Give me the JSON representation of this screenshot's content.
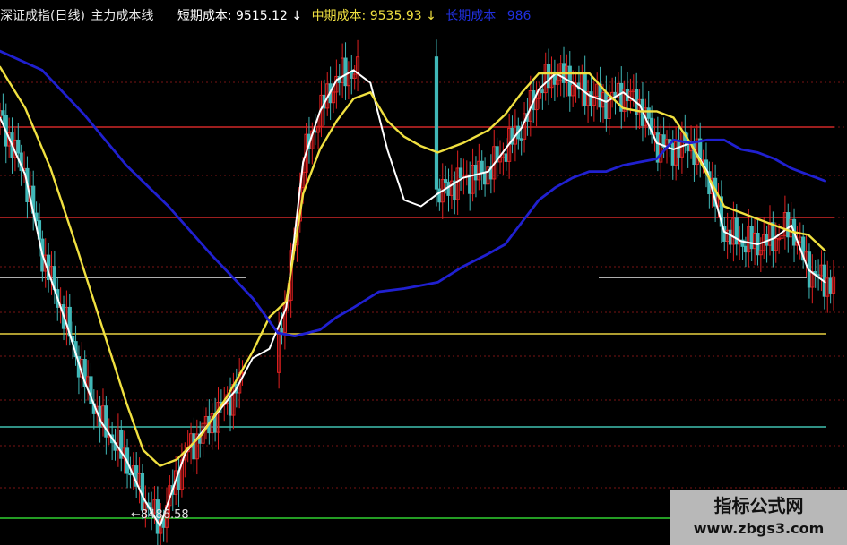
{
  "header": {
    "title": "深证成指(日线)",
    "indicator": "主力成本线",
    "short_label": "短期成本:",
    "short_value": "9515.12",
    "mid_label": "中期成本:",
    "mid_value": "9535.93",
    "long_label": "长期成本",
    "long_value": "986",
    "down_arrow": "↓"
  },
  "low_marker": "←8486.58",
  "watermark": {
    "line1": "指标公式网",
    "line2": "www.zbgs3.com"
  },
  "colors": {
    "up": "#e02020",
    "down": "#40b8b8",
    "short_line": "#ffffff",
    "mid_line": "#f0e040",
    "long_line": "#2020d0",
    "header_short": "#ffffff",
    "header_mid": "#f0e040",
    "header_long": "#2030e0"
  },
  "chart_data": {
    "type": "line",
    "title": "深证成指(日线) 主力成本线",
    "y_unit": "index points",
    "ylim": [
      8430,
      10050
    ],
    "x_count": 100,
    "series": [
      {
        "name": "短期成本",
        "color": "#ffffff",
        "x": [
          0,
          3,
          5,
          8,
          10,
          12,
          15,
          17,
          19,
          22,
          25,
          28,
          30,
          32,
          34,
          36,
          38,
          40,
          42,
          44,
          46,
          48,
          50,
          52,
          55,
          58,
          60,
          62,
          64,
          66,
          68,
          70,
          72,
          74,
          76,
          78,
          80,
          82,
          84,
          86,
          88,
          90,
          92,
          94,
          96,
          98
        ],
        "y": [
          9780,
          9600,
          9350,
          9120,
          8950,
          8820,
          8700,
          8580,
          8490,
          8720,
          8820,
          8920,
          9020,
          9050,
          9180,
          9640,
          9800,
          9900,
          9930,
          9890,
          9680,
          9520,
          9500,
          9540,
          9590,
          9610,
          9680,
          9750,
          9870,
          9920,
          9890,
          9850,
          9830,
          9860,
          9820,
          9700,
          9680,
          9700,
          9610,
          9420,
          9390,
          9380,
          9400,
          9440,
          9300,
          9260
        ]
      },
      {
        "name": "中期成本",
        "color": "#f0e040",
        "x": [
          0,
          3,
          6,
          9,
          12,
          15,
          17,
          19,
          21,
          24,
          27,
          30,
          32,
          34,
          36,
          38,
          40,
          42,
          44,
          46,
          48,
          50,
          52,
          55,
          58,
          60,
          62,
          64,
          66,
          68,
          70,
          72,
          74,
          76,
          78,
          80,
          82,
          84,
          86,
          88,
          90,
          92,
          94,
          96,
          98
        ],
        "y": [
          9940,
          9810,
          9620,
          9380,
          9130,
          8880,
          8730,
          8680,
          8700,
          8780,
          8900,
          9040,
          9150,
          9200,
          9540,
          9680,
          9770,
          9840,
          9860,
          9770,
          9720,
          9690,
          9670,
          9700,
          9740,
          9790,
          9860,
          9920,
          9920,
          9920,
          9920,
          9860,
          9810,
          9800,
          9800,
          9780,
          9700,
          9600,
          9500,
          9480,
          9460,
          9440,
          9420,
          9410,
          9360
        ]
      },
      {
        "name": "长期成本",
        "color": "#2020d0",
        "x": [
          0,
          5,
          10,
          15,
          20,
          25,
          30,
          33,
          35,
          38,
          40,
          42,
          45,
          48,
          50,
          52,
          55,
          58,
          60,
          62,
          64,
          66,
          68,
          70,
          72,
          74,
          76,
          78,
          80,
          82,
          84,
          86,
          88,
          90,
          92,
          94,
          96,
          98
        ],
        "y": [
          9990,
          9930,
          9790,
          9630,
          9500,
          9350,
          9210,
          9100,
          9090,
          9110,
          9150,
          9180,
          9230,
          9240,
          9250,
          9260,
          9310,
          9350,
          9380,
          9450,
          9520,
          9560,
          9590,
          9610,
          9610,
          9630,
          9640,
          9650,
          9710,
          9700,
          9710,
          9710,
          9680,
          9670,
          9650,
          9620,
          9600,
          9580
        ]
      }
    ]
  }
}
